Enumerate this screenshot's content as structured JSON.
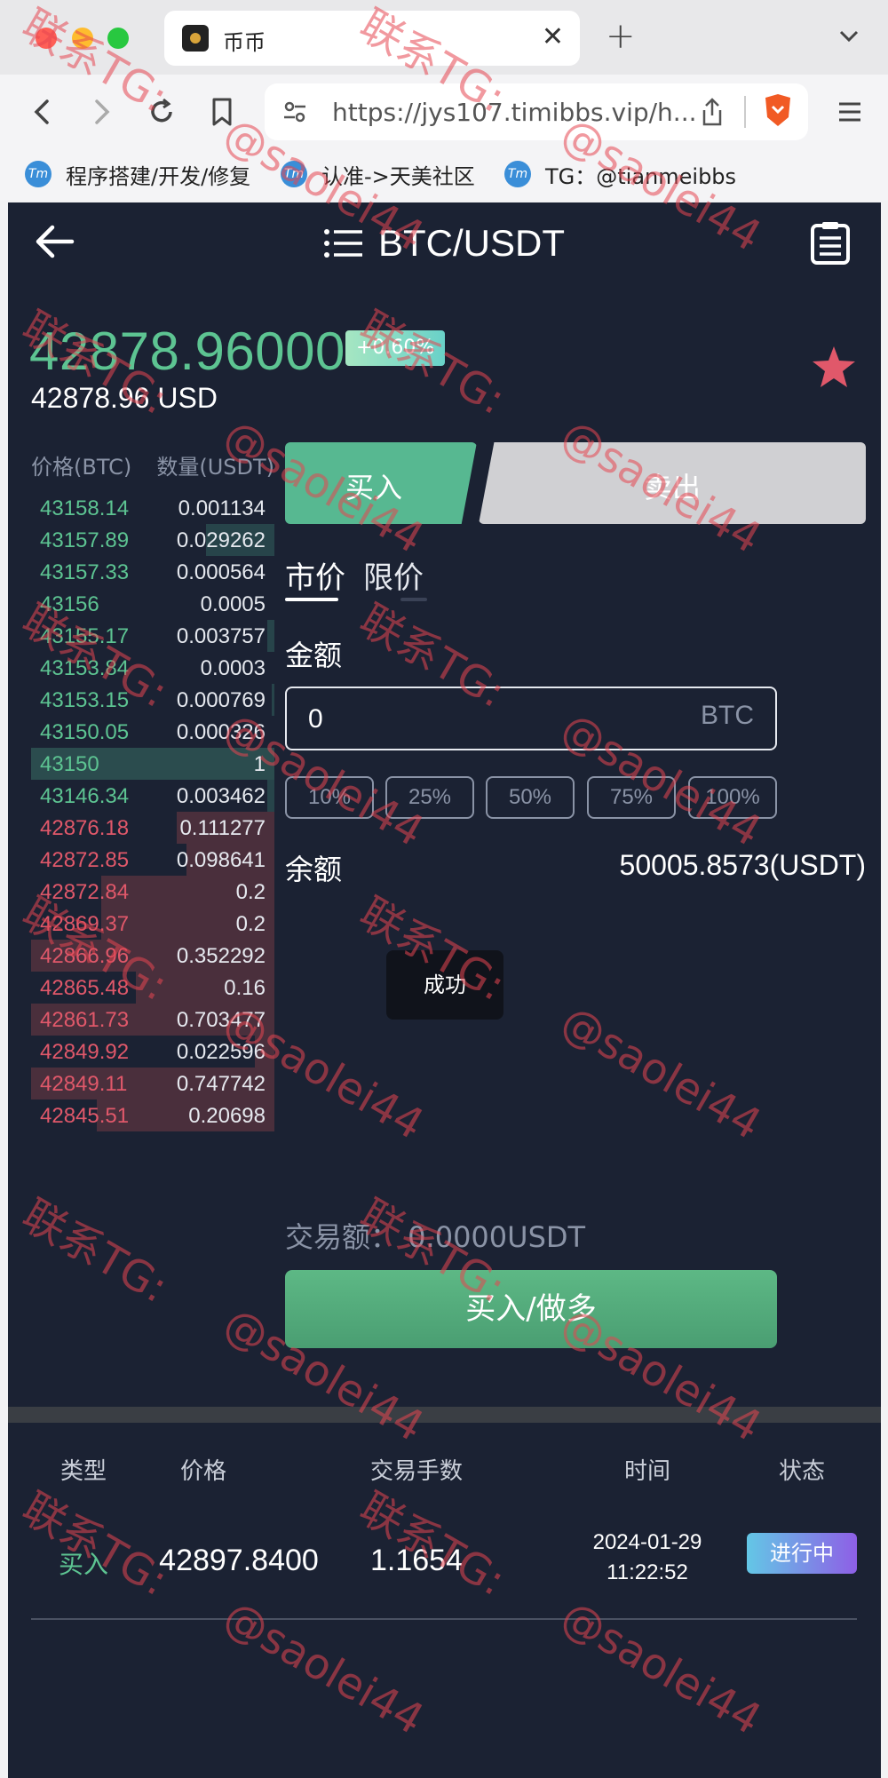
{
  "browser": {
    "tab_title": "币币",
    "url": "https://jys107.timibbs.vip/h...",
    "bookmarks": [
      {
        "label": "程序搭建/开发/修复"
      },
      {
        "label": "认准->天美社区"
      },
      {
        "label": "TG：@tianmeibbs"
      }
    ]
  },
  "header": {
    "pair": "BTC/USDT"
  },
  "ticker": {
    "price": "42878.96000",
    "change": "+0.60%",
    "price_usd": "42878.96 USD"
  },
  "orderbook": {
    "price_header": "价格(BTC)",
    "qty_header": "数量(USDT)",
    "asks": [
      {
        "price": "43158.14",
        "qty": "0.001134",
        "depth": 0.0
      },
      {
        "price": "43157.89",
        "qty": "0.029262",
        "depth": 0.28
      },
      {
        "price": "43157.33",
        "qty": "0.000564",
        "depth": 0.0
      },
      {
        "price": "43156",
        "qty": "0.0005",
        "depth": 0.0
      },
      {
        "price": "43155.17",
        "qty": "0.003757",
        "depth": 0.03
      },
      {
        "price": "43153.84",
        "qty": "0.0003",
        "depth": 0.0
      },
      {
        "price": "43153.15",
        "qty": "0.000769",
        "depth": 0.01
      },
      {
        "price": "43150.05",
        "qty": "0.000326",
        "depth": 0.0
      }
    ],
    "mid": {
      "price": "43150",
      "qty": "1"
    },
    "bids_top": [
      {
        "price": "43146.34",
        "qty": "0.003462",
        "depth": 0.03
      }
    ],
    "bids": [
      {
        "price": "42876.18",
        "qty": "0.111277",
        "depth": 0.4
      },
      {
        "price": "42872.85",
        "qty": "0.098641",
        "depth": 0.36
      },
      {
        "price": "42872.84",
        "qty": "0.2",
        "depth": 0.71
      },
      {
        "price": "42869.37",
        "qty": "0.2",
        "depth": 0.71
      },
      {
        "price": "42866.96",
        "qty": "0.352292",
        "depth": 1.0
      },
      {
        "price": "42865.48",
        "qty": "0.16",
        "depth": 0.57
      },
      {
        "price": "42861.73",
        "qty": "0.703477",
        "depth": 1.0
      },
      {
        "price": "42849.92",
        "qty": "0.022596",
        "depth": 0.08
      },
      {
        "price": "42849.11",
        "qty": "0.747742",
        "depth": 1.0
      },
      {
        "price": "42845.51",
        "qty": "0.20698",
        "depth": 0.73
      }
    ]
  },
  "trade": {
    "buy_tab": "买入",
    "sell_tab": "卖出",
    "type_market": "市价",
    "type_limit": "限价",
    "amount_label": "金额",
    "amount_value": "0",
    "amount_unit": "BTC",
    "percents": [
      "10%",
      "25%",
      "50%",
      "75%",
      "100%"
    ],
    "balance_label": "余额",
    "balance_value": "50005.8573(USDT)",
    "toast": "成功",
    "trade_amount": "交易额：  0.0000USDT",
    "submit": "买入/做多"
  },
  "orders_table": {
    "headers": [
      "类型",
      "价格",
      "交易手数",
      "时间",
      "状态"
    ],
    "rows": [
      {
        "type": "买入",
        "price": "42897.8400",
        "lots": "1.1654",
        "date": "2024-01-29",
        "time": "11:22:52",
        "status": "进行中"
      }
    ]
  },
  "watermark": {
    "line1": "联系TG:",
    "line2": "@saolei44"
  }
}
